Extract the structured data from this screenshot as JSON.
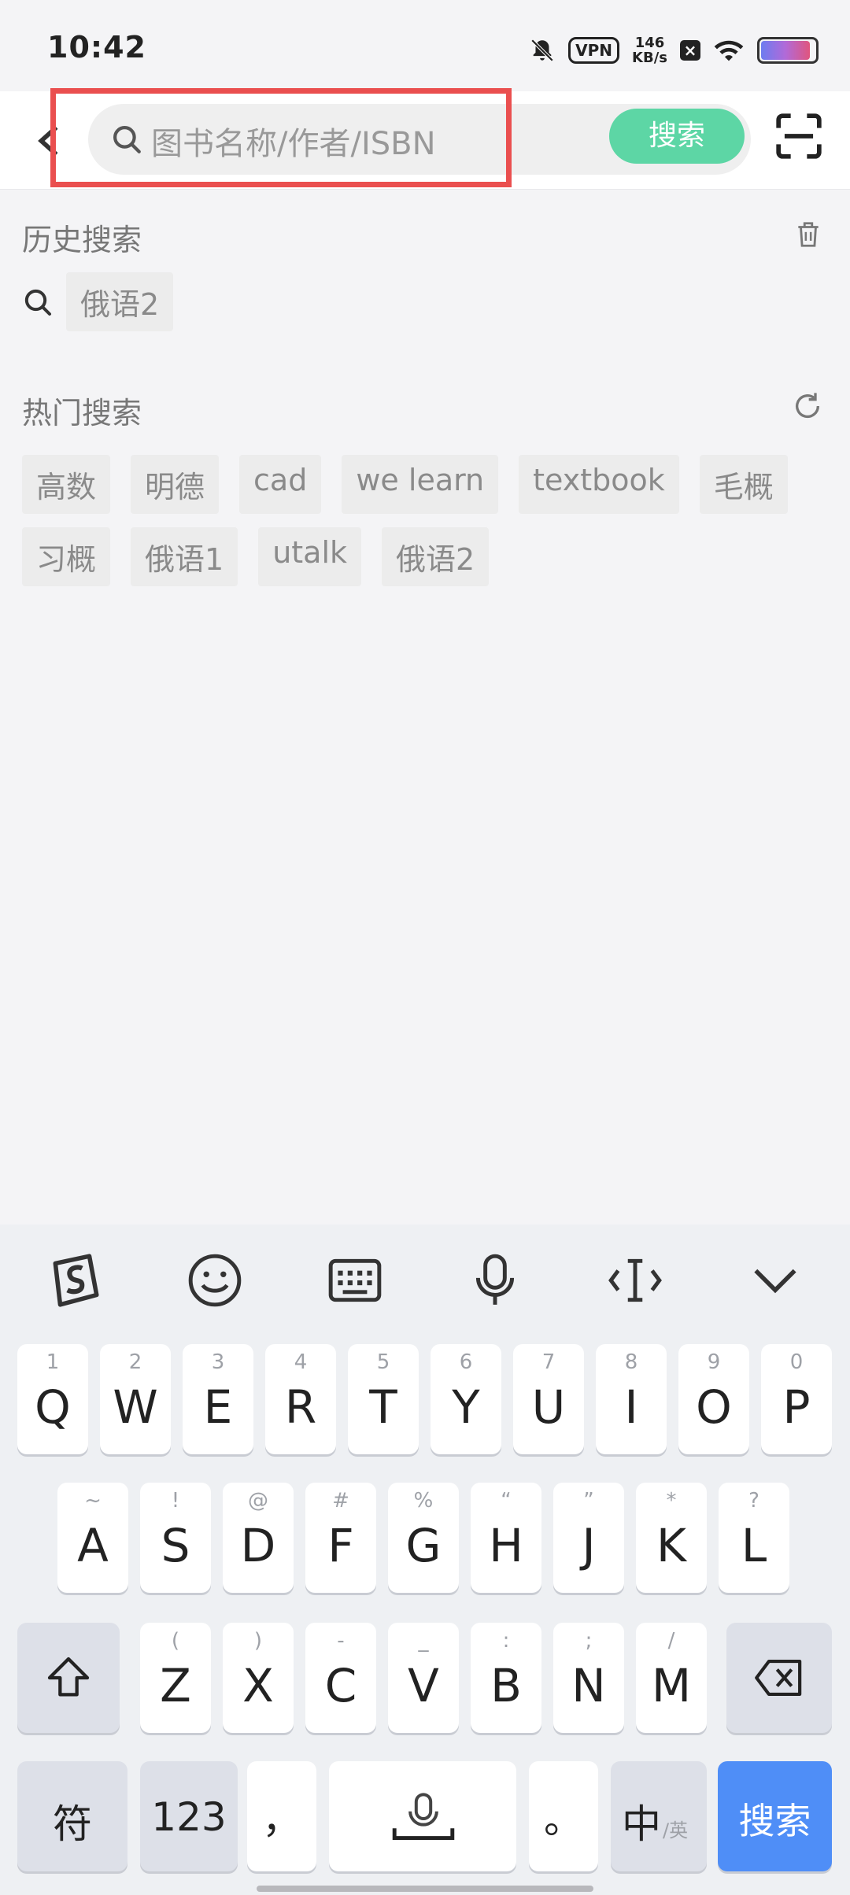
{
  "status": {
    "time": "10:42",
    "vpn": "VPN",
    "speed_value": "146",
    "speed_unit": "KB/s"
  },
  "header": {
    "search_placeholder": "图书名称/作者/ISBN",
    "search_button": "搜索"
  },
  "history": {
    "title": "历史搜索",
    "items": [
      "俄语2"
    ]
  },
  "hot": {
    "title": "热门搜索",
    "row1": [
      "高数",
      "明德",
      "cad",
      "we learn",
      "textbook",
      "毛概"
    ],
    "row2": [
      "习概",
      "俄语1",
      "utalk",
      "俄语2"
    ]
  },
  "keyboard": {
    "row1": [
      {
        "sub": "1",
        "main": "Q"
      },
      {
        "sub": "2",
        "main": "W"
      },
      {
        "sub": "3",
        "main": "E"
      },
      {
        "sub": "4",
        "main": "R"
      },
      {
        "sub": "5",
        "main": "T"
      },
      {
        "sub": "6",
        "main": "Y"
      },
      {
        "sub": "7",
        "main": "U"
      },
      {
        "sub": "8",
        "main": "I"
      },
      {
        "sub": "9",
        "main": "O"
      },
      {
        "sub": "0",
        "main": "P"
      }
    ],
    "row2": [
      {
        "sub": "~",
        "main": "A"
      },
      {
        "sub": "!",
        "main": "S"
      },
      {
        "sub": "@",
        "main": "D"
      },
      {
        "sub": "#",
        "main": "F"
      },
      {
        "sub": "%",
        "main": "G"
      },
      {
        "sub": "“",
        "main": "H"
      },
      {
        "sub": "”",
        "main": "J"
      },
      {
        "sub": "*",
        "main": "K"
      },
      {
        "sub": "?",
        "main": "L"
      }
    ],
    "row3": [
      {
        "sub": "(",
        "main": "Z"
      },
      {
        "sub": ")",
        "main": "X"
      },
      {
        "sub": "-",
        "main": "C"
      },
      {
        "sub": "_",
        "main": "V"
      },
      {
        "sub": ":",
        "main": "B"
      },
      {
        "sub": ";",
        "main": "N"
      },
      {
        "sub": "/",
        "main": "M"
      }
    ],
    "symbols": "符",
    "numbers": "123",
    "comma": "，",
    "period": "。",
    "lang_main": "中",
    "lang_sub": "/英",
    "enter": "搜索"
  }
}
